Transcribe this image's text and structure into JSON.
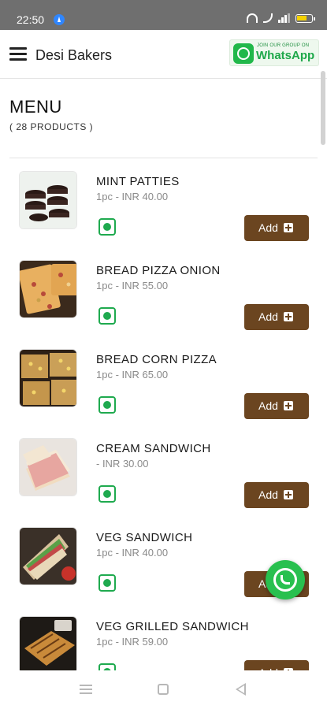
{
  "status_bar": {
    "time": "22:50",
    "icons": [
      "location-icon",
      "wifi-icon",
      "wifi-call-icon",
      "signal-icon",
      "battery-icon"
    ]
  },
  "header": {
    "menu_icon": "hamburger-icon",
    "brand": "Desi Bakers",
    "whatsapp_banner": {
      "small_text": "JOIN OUR GROUP ON",
      "big_text": "WhatsApp",
      "color": "#21b84a"
    }
  },
  "menu": {
    "title": "MENU",
    "count_label": "( 28 PRODUCTS )"
  },
  "products": [
    {
      "name": "MINT PATTIES",
      "price": "1pc - INR 40.00",
      "veg": true,
      "add_label": "Add",
      "image": "mint-patties"
    },
    {
      "name": "BREAD PIZZA ONION",
      "price": "1pc - INR 55.00",
      "veg": true,
      "add_label": "Add",
      "image": "bread-pizza-onion"
    },
    {
      "name": "BREAD CORN PIZZA",
      "price": "1pc - INR 65.00",
      "veg": true,
      "add_label": "Add",
      "image": "bread-corn-pizza"
    },
    {
      "name": "CREAM SANDWICH",
      "price": "- INR 30.00",
      "veg": true,
      "add_label": "Add",
      "image": "cream-sandwich"
    },
    {
      "name": "VEG SANDWICH",
      "price": "1pc - INR 40.00",
      "veg": true,
      "add_label": "Add",
      "image": "veg-sandwich"
    },
    {
      "name": "VEG GRILLED SANDWICH",
      "price": "1pc - INR 59.00",
      "veg": true,
      "add_label": "Add",
      "image": "veg-grilled-sandwich"
    }
  ],
  "colors": {
    "add_button": "#6b4520",
    "veg_mark": "#1faa4f",
    "status_bar": "#6f6f6f"
  },
  "floating_button": {
    "icon": "whatsapp-icon"
  },
  "nav_bar": {
    "icons": [
      "recent-apps-icon",
      "home-icon",
      "back-icon"
    ]
  }
}
